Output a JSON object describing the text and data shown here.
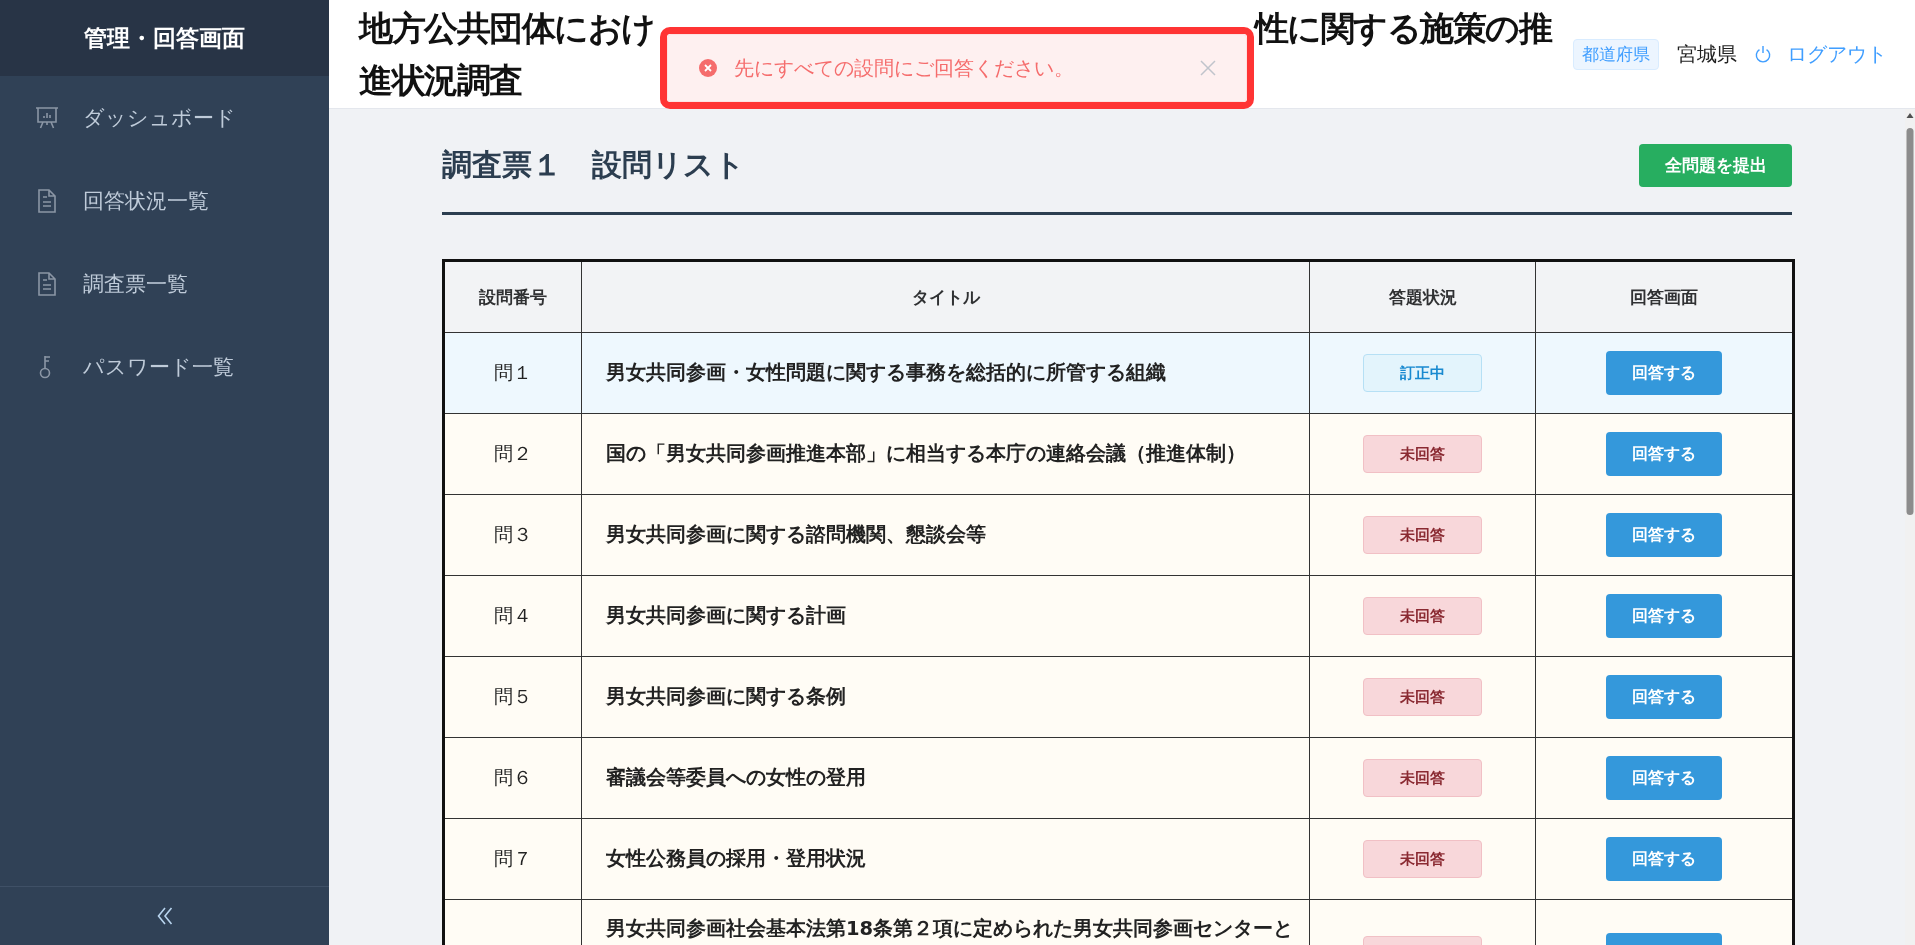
{
  "sidebar": {
    "title": "管理・回答画面",
    "items": [
      {
        "label": "ダッシュボード",
        "selected": false
      },
      {
        "label": "回答状況一覧",
        "selected": false
      },
      {
        "label": "調査票一覧",
        "selected": false
      },
      {
        "label": "パスワード一覧",
        "selected": false
      }
    ]
  },
  "header": {
    "title_lines": [
      [
        "地方公共団体におけ",
        "性に関する施策の推"
      ],
      [
        "進状況調査"
      ]
    ],
    "user_type": "都道府県",
    "user_name": "宮城県",
    "logout": "ログアウト"
  },
  "toast": {
    "kind": "error",
    "message": "先にすべての設問にご回答ください。",
    "highlighted": true
  },
  "page": {
    "heading": "調査票１　設問リスト",
    "submit_button": "全問題を提出"
  },
  "table": {
    "columns": [
      "設問番号",
      "タイトル",
      "答題状況",
      "回答画面"
    ],
    "rows": [
      {
        "number": "問１",
        "title": "男女共同参画・女性問題に関する事務を総括的に所管する組織",
        "status": {
          "label": "訂正中",
          "kind": "correcting"
        },
        "action": "回答する"
      },
      {
        "number": "問２",
        "title": "国の「男女共同参画推進本部」に相当する本庁の連絡会議（推進体制）",
        "status": {
          "label": "未回答",
          "kind": "unanswered"
        },
        "action": "回答する"
      },
      {
        "number": "問３",
        "title": "男女共同参画に関する諮問機関、懇談会等",
        "status": {
          "label": "未回答",
          "kind": "unanswered"
        },
        "action": "回答する"
      },
      {
        "number": "問４",
        "title": "男女共同参画に関する計画",
        "status": {
          "label": "未回答",
          "kind": "unanswered"
        },
        "action": "回答する"
      },
      {
        "number": "問５",
        "title": "男女共同参画に関する条例",
        "status": {
          "label": "未回答",
          "kind": "unanswered"
        },
        "action": "回答する"
      },
      {
        "number": "問６",
        "title": "審議会等委員への女性の登用",
        "status": {
          "label": "未回答",
          "kind": "unanswered"
        },
        "action": "回答する"
      },
      {
        "number": "問７",
        "title": "女性公務員の採用・登用状況",
        "status": {
          "label": "未回答",
          "kind": "unanswered"
        },
        "action": "回答する"
      },
      {
        "title": "男女共同参画社会基本法第18条第２項に定められた男女共同参画センターと",
        "status": {
          "kind": "unanswered"
        }
      }
    ]
  }
}
